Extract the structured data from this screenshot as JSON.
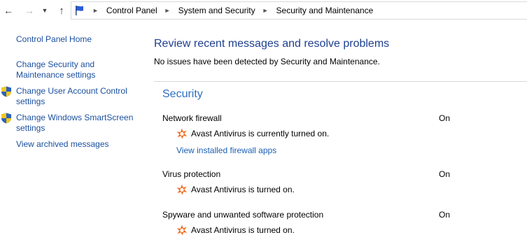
{
  "breadcrumb": {
    "items": [
      "Control Panel",
      "System and Security",
      "Security and Maintenance"
    ]
  },
  "nav": {
    "back": "←",
    "forward": "→",
    "recent": "⌄",
    "up": "↑"
  },
  "sidebar": {
    "home": "Control Panel Home",
    "links": [
      [
        "Change Security and",
        "Maintenance settings"
      ],
      [
        "Change User Account Control",
        "settings"
      ],
      [
        "Change Windows SmartScreen",
        "settings"
      ]
    ],
    "archived": "View archived messages"
  },
  "main": {
    "title": "Review recent messages and resolve problems",
    "no_issues": "No issues have been detected by Security and Maintenance.",
    "section": "Security",
    "items": [
      {
        "label": "Network firewall",
        "status": "On",
        "detail": "Avast Antivirus is currently turned on.",
        "link": "View installed firewall apps"
      },
      {
        "label": "Virus protection",
        "status": "On",
        "detail": "Avast Antivirus is turned on."
      },
      {
        "label": "Spyware and unwanted software protection",
        "status": "On",
        "detail": "Avast Antivirus is turned on."
      }
    ]
  },
  "colors": {
    "link": "#1a4f9f",
    "title": "#1e3f8f",
    "section": "#2f6fbf",
    "avast": "#f26b21"
  }
}
